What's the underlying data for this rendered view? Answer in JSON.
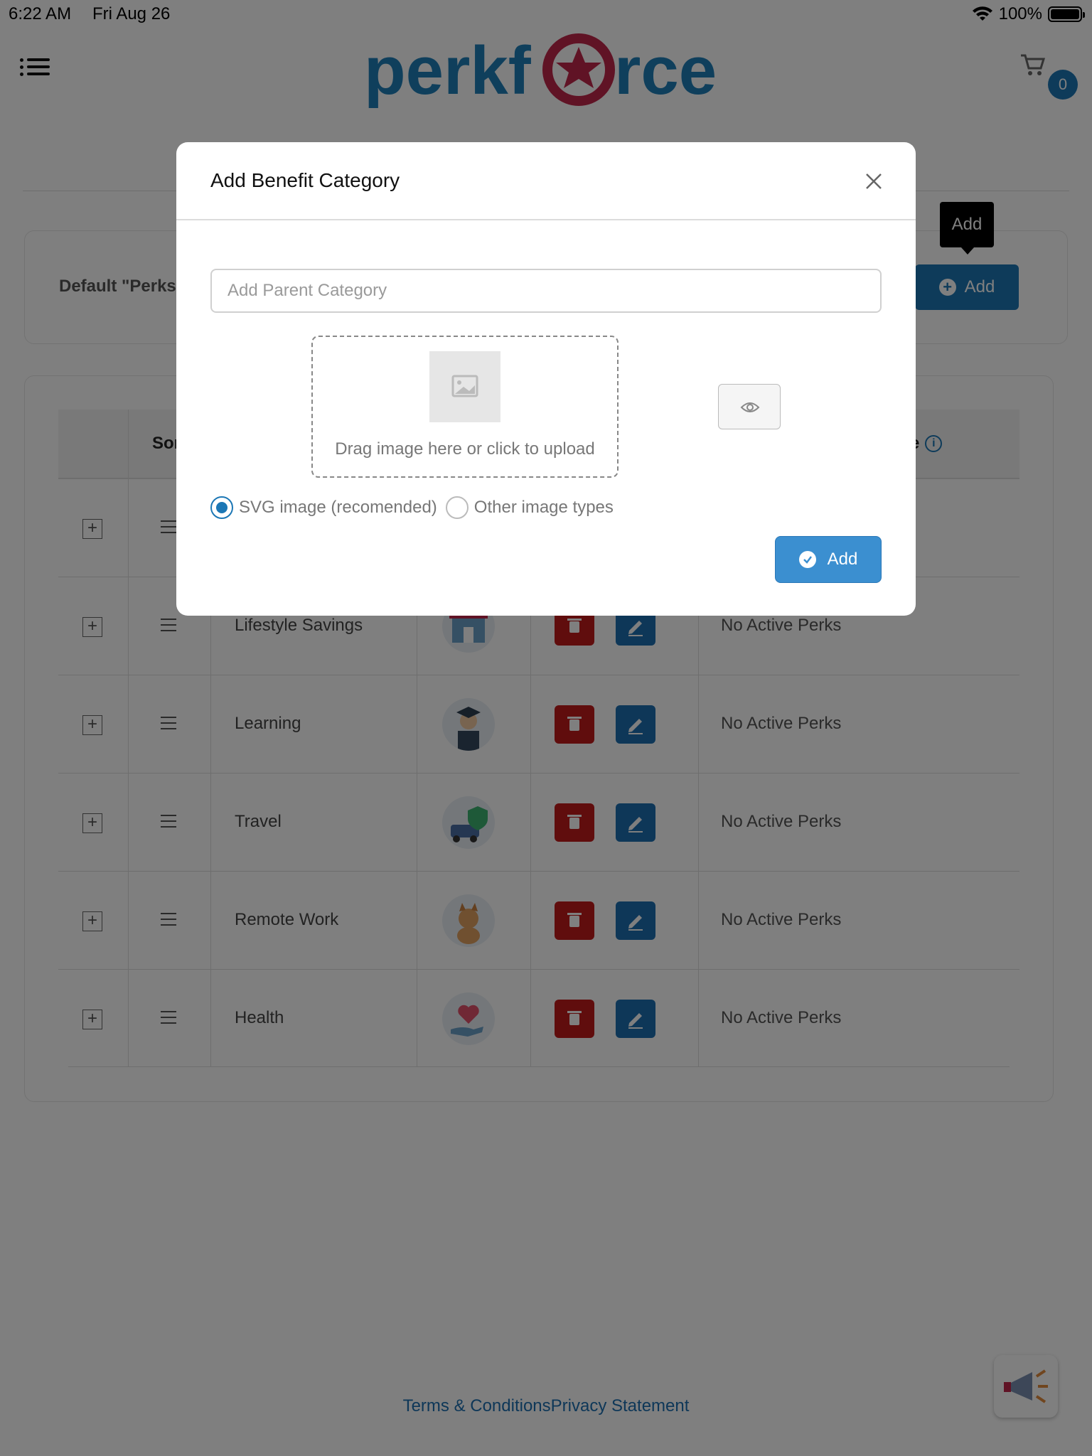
{
  "status_bar": {
    "time": "6:22 AM",
    "date": "Fri Aug 26",
    "battery": "100%"
  },
  "header": {
    "logo_text": "perkforce",
    "cart_count": "0"
  },
  "settings_card": {
    "title": "Default \"Perks",
    "add_label": "Add",
    "tooltip": "Add"
  },
  "table": {
    "columns": {
      "sort": "Sor",
      "image": "age"
    },
    "rows": [
      {
        "name": "Lifestyle Savings",
        "status": "No Active Perks"
      },
      {
        "name": "Learning",
        "status": "No Active Perks"
      },
      {
        "name": "Travel",
        "status": "No Active Perks"
      },
      {
        "name": "Remote Work",
        "status": "No Active Perks"
      },
      {
        "name": "Health",
        "status": "No Active Perks"
      }
    ]
  },
  "modal": {
    "title": "Add Benefit Category",
    "input_placeholder": "Add Parent Category",
    "dropzone_text": "Drag image here or click to upload",
    "radio_svg": "SVG image (recomended)",
    "radio_other": "Other image types",
    "add_label": "Add"
  },
  "footer": {
    "terms": "Terms & Conditions",
    "privacy": "Privacy Statement"
  },
  "colors": {
    "brand_blue": "#1c77b5",
    "danger_red": "#c11b1b",
    "logo_red": "#c0264a"
  }
}
